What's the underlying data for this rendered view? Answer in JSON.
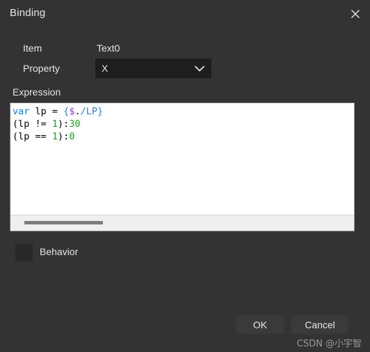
{
  "window": {
    "title": "Binding",
    "close_icon": "close-icon"
  },
  "form": {
    "item_label": "Item",
    "item_value": "Text0",
    "property_label": "Property",
    "property_value": "X",
    "property_caret_icon": "chevron-down-icon"
  },
  "expression": {
    "label": "Expression",
    "lines": [
      {
        "tokens": [
          {
            "text": "var",
            "type": "keyword"
          },
          {
            "text": " lp = ",
            "type": "plain"
          },
          {
            "text": "{",
            "type": "brace"
          },
          {
            "text": "$",
            "type": "variable"
          },
          {
            "text": ".",
            "type": "plain"
          },
          {
            "text": "/LP",
            "type": "path"
          },
          {
            "text": "}",
            "type": "brace"
          }
        ],
        "plain": "var lp = {$./LP}"
      },
      {
        "tokens": [
          {
            "text": "(lp != ",
            "type": "plain"
          },
          {
            "text": "1",
            "type": "number"
          },
          {
            "text": "):",
            "type": "plain"
          },
          {
            "text": "30",
            "type": "number"
          }
        ],
        "plain": "(lp != 1):30"
      },
      {
        "tokens": [
          {
            "text": "(lp == ",
            "type": "plain"
          },
          {
            "text": "1",
            "type": "number"
          },
          {
            "text": "):",
            "type": "plain"
          },
          {
            "text": "0",
            "type": "number"
          }
        ],
        "plain": "(lp == 1):0"
      }
    ]
  },
  "behavior": {
    "label": "Behavior",
    "swatch_color": "#282828"
  },
  "footer": {
    "ok_label": "OK",
    "cancel_label": "Cancel"
  },
  "watermark": {
    "text": "CSDN @小宇智"
  },
  "colors": {
    "dialog_bg": "#333333",
    "input_bg": "#1e1e1e",
    "button_bg": "#3a3a3a",
    "text": "#e6e6e6",
    "editor_bg": "#ffffff",
    "keyword": "#0b82d0",
    "number": "#1a9e1a",
    "variable": "#9333c4",
    "scrollbar_thumb": "#7d7d7d"
  }
}
